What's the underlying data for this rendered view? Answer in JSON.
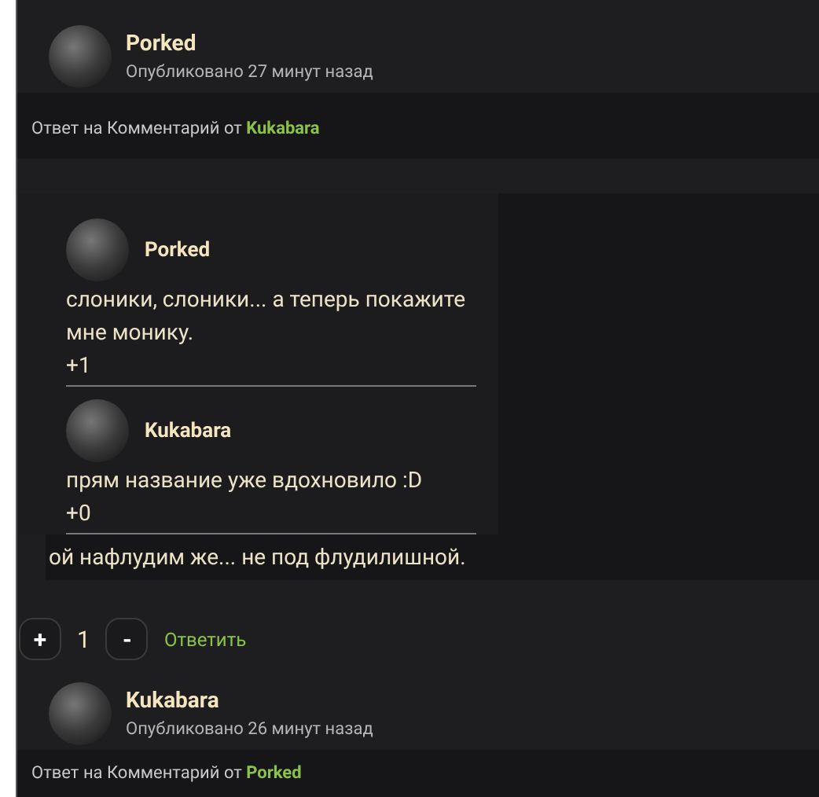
{
  "comments": [
    {
      "author": "Porked",
      "published": "Опубликовано 27 минут назад",
      "reply_prefix": "Ответ на Комментарий от",
      "reply_to": "Kukabara",
      "quotes": [
        {
          "author": "Porked",
          "text": "слоники, слоники... а теперь покажите мне монику.",
          "score": "+1"
        },
        {
          "author": "Kukabara",
          "text": "прям название уже вдохновило :D",
          "score": "+0"
        }
      ],
      "text": "ой нафлудим же... не под флудилишной.",
      "upvote": "+",
      "score": "1",
      "downvote": "-",
      "reply_button": "Ответить"
    },
    {
      "author": "Kukabara",
      "published": "Опубликовано 26 минут назад",
      "reply_prefix": "Ответ на Комментарий от",
      "reply_to": "Porked"
    }
  ]
}
